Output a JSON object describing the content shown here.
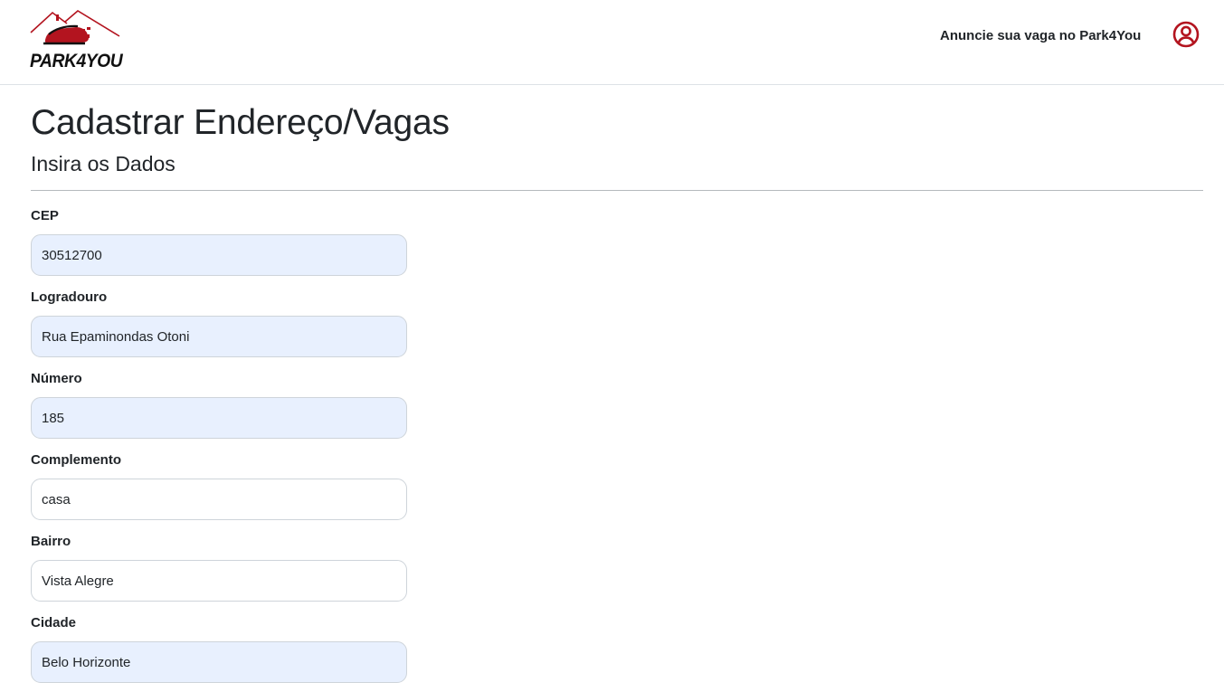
{
  "navbar": {
    "logo_text": "PARK4YOU",
    "advertise_link": "Anuncie sua vaga no Park4You",
    "user_icon": "user-circle-icon",
    "logo_icon": "house-car-logo",
    "colors": {
      "brand_red": "#b3141f",
      "logo_dark": "#111111"
    }
  },
  "page": {
    "title": "Cadastrar Endereço/Vagas",
    "subtitle": "Insira os Dados"
  },
  "form": {
    "fields": [
      {
        "label": "CEP",
        "value": "30512700",
        "autofilled": true
      },
      {
        "label": "Logradouro",
        "value": "Rua Epaminondas Otoni",
        "autofilled": true
      },
      {
        "label": "Número",
        "value": "185",
        "autofilled": true
      },
      {
        "label": "Complemento",
        "value": "casa",
        "autofilled": false
      },
      {
        "label": "Bairro",
        "value": "Vista Alegre",
        "autofilled": false
      },
      {
        "label": "Cidade",
        "value": "Belo Horizonte",
        "autofilled": true
      }
    ],
    "colors": {
      "autofill_bg": "#e8f0fe",
      "border": "#ced4da"
    }
  }
}
